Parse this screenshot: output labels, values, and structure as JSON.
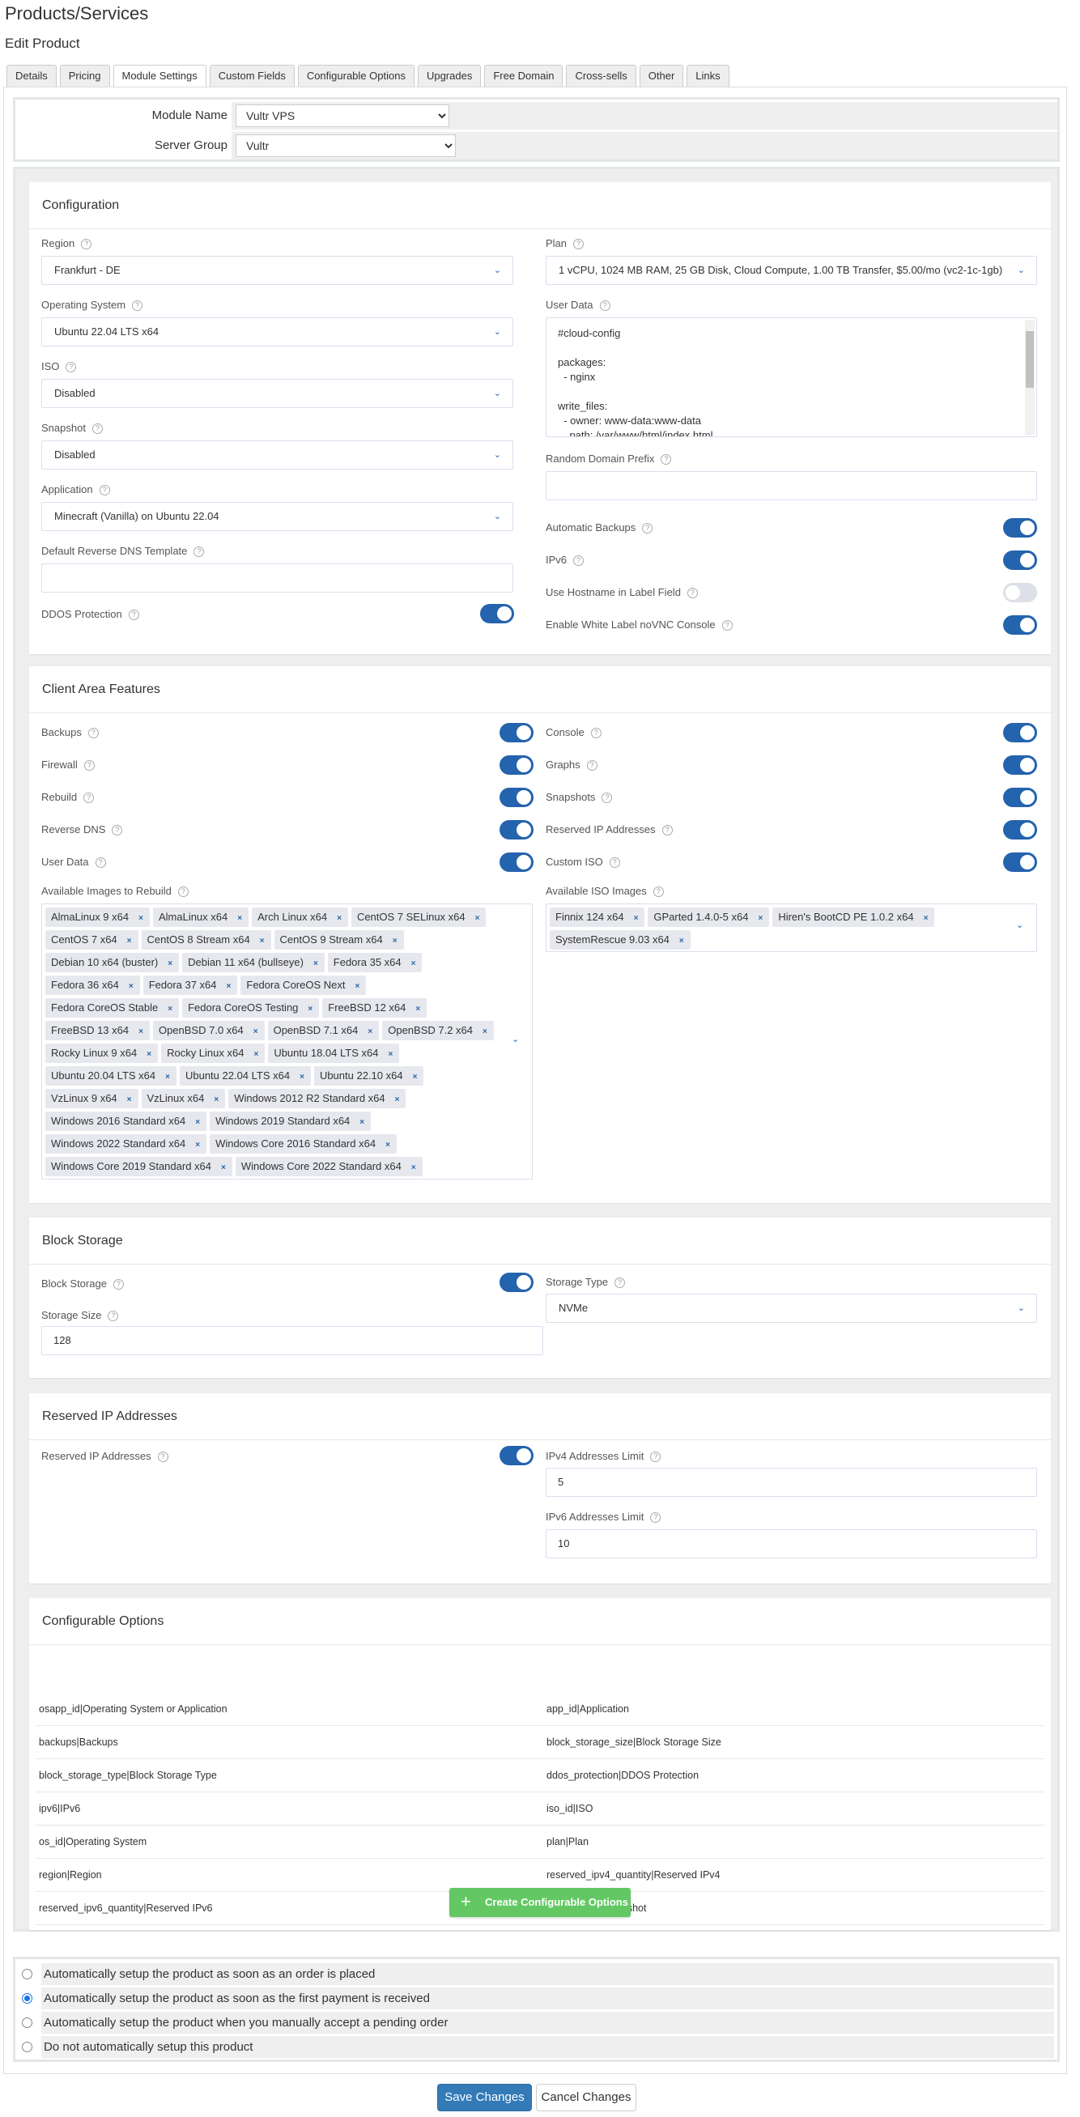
{
  "page": {
    "title": "Products/Services",
    "subtitle": "Edit Product"
  },
  "tabs": [
    {
      "label": "Details"
    },
    {
      "label": "Pricing"
    },
    {
      "label": "Module Settings",
      "active": true
    },
    {
      "label": "Custom Fields"
    },
    {
      "label": "Configurable Options"
    },
    {
      "label": "Upgrades"
    },
    {
      "label": "Free Domain"
    },
    {
      "label": "Cross-sells"
    },
    {
      "label": "Other"
    },
    {
      "label": "Links"
    }
  ],
  "module": {
    "name_label": "Module Name",
    "name_value": "Vultr VPS",
    "group_label": "Server Group",
    "group_value": "Vultr"
  },
  "help_glyph": "?",
  "chevron_glyph": "⌄",
  "remove_glyph": "×",
  "configuration": {
    "title": "Configuration",
    "region": {
      "label": "Region",
      "value": "Frankfurt - DE"
    },
    "os": {
      "label": "Operating System",
      "value": "Ubuntu 22.04 LTS x64"
    },
    "iso": {
      "label": "ISO",
      "value": "Disabled"
    },
    "snapshot": {
      "label": "Snapshot",
      "value": "Disabled"
    },
    "application": {
      "label": "Application",
      "value": "Minecraft (Vanilla) on Ubuntu 22.04"
    },
    "rdns": {
      "label": "Default Reverse DNS Template",
      "value": ""
    },
    "ddos": {
      "label": "DDOS Protection",
      "on": true
    },
    "plan": {
      "label": "Plan",
      "value": "1 vCPU, 1024 MB RAM, 25 GB Disk, Cloud Compute, 1.00 TB Transfer, $5.00/mo (vc2-1c-1gb)"
    },
    "user_data": {
      "label": "User Data",
      "value": "#cloud-config\n\npackages:\n  - nginx\n\nwrite_files:\n  - owner: www-data:www-data\n    path: /var/www/html/index.html"
    },
    "random_prefix": {
      "label": "Random Domain Prefix",
      "value": ""
    },
    "auto_backups": {
      "label": "Automatic Backups",
      "on": true
    },
    "ipv6": {
      "label": "IPv6",
      "on": true
    },
    "hostname_label": {
      "label": "Use Hostname in Label Field",
      "on": false
    },
    "white_label": {
      "label": "Enable White Label noVNC Console",
      "on": true
    }
  },
  "client_area": {
    "title": "Client Area Features",
    "left": [
      {
        "label": "Backups",
        "on": true
      },
      {
        "label": "Firewall",
        "on": true
      },
      {
        "label": "Rebuild",
        "on": true
      },
      {
        "label": "Reverse DNS",
        "on": true
      },
      {
        "label": "User Data",
        "on": true
      }
    ],
    "right": [
      {
        "label": "Console",
        "on": true
      },
      {
        "label": "Graphs",
        "on": true
      },
      {
        "label": "Snapshots",
        "on": true
      },
      {
        "label": "Reserved IP Addresses",
        "on": true
      },
      {
        "label": "Custom ISO",
        "on": true
      }
    ],
    "images_label": "Available Images to Rebuild",
    "images": [
      "AlmaLinux 9 x64",
      "AlmaLinux x64",
      "Arch Linux x64",
      "CentOS 7 SELinux x64",
      "CentOS 7 x64",
      "CentOS 8 Stream x64",
      "CentOS 9 Stream x64",
      "Debian 10 x64 (buster)",
      "Debian 11 x64 (bullseye)",
      "Fedora 35 x64",
      "Fedora 36 x64",
      "Fedora 37 x64",
      "Fedora CoreOS Next",
      "Fedora CoreOS Stable",
      "Fedora CoreOS Testing",
      "FreeBSD 12 x64",
      "FreeBSD 13 x64",
      "OpenBSD 7.0 x64",
      "OpenBSD 7.1 x64",
      "OpenBSD 7.2 x64",
      "Rocky Linux 9 x64",
      "Rocky Linux x64",
      "Ubuntu 18.04 LTS x64",
      "Ubuntu 20.04 LTS x64",
      "Ubuntu 22.04 LTS x64",
      "Ubuntu 22.10 x64",
      "VzLinux 9 x64",
      "VzLinux x64",
      "Windows 2012 R2 Standard x64",
      "Windows 2016 Standard x64",
      "Windows 2019 Standard x64",
      "Windows 2022 Standard x64",
      "Windows Core 2016 Standard x64",
      "Windows Core 2019 Standard x64",
      "Windows Core 2022 Standard x64"
    ],
    "iso_label": "Available ISO Images",
    "isos": [
      "Finnix 124 x64",
      "GParted 1.4.0-5 x64",
      "Hiren's BootCD PE 1.0.2 x64",
      "SystemRescue 9.03 x64"
    ]
  },
  "block_storage": {
    "title": "Block Storage",
    "enabled": {
      "label": "Block Storage",
      "on": true
    },
    "size": {
      "label": "Storage Size",
      "value": "128"
    },
    "type": {
      "label": "Storage Type",
      "value": "NVMe"
    }
  },
  "reserved_ip": {
    "title": "Reserved IP Addresses",
    "enabled": {
      "label": "Reserved IP Addresses",
      "on": true
    },
    "ipv4": {
      "label": "IPv4 Addresses Limit",
      "value": "5"
    },
    "ipv6": {
      "label": "IPv6 Addresses Limit",
      "value": "10"
    }
  },
  "configurable_options": {
    "title": "Configurable Options",
    "rows": [
      [
        "osapp_id|Operating System or Application",
        "app_id|Application"
      ],
      [
        "backups|Backups",
        "block_storage_size|Block Storage Size"
      ],
      [
        "block_storage_type|Block Storage Type",
        "ddos_protection|DDOS Protection"
      ],
      [
        "ipv6|IPv6",
        "iso_id|ISO"
      ],
      [
        "os_id|Operating System",
        "plan|Plan"
      ],
      [
        "region|Region",
        "reserved_ipv4_quantity|Reserved IPv4"
      ],
      [
        "reserved_ipv6_quantity|Reserved IPv6",
        "snapshot_id|Snapshot"
      ]
    ],
    "create_label": "Create Configurable Options",
    "plus_glyph": "+"
  },
  "setup_options": [
    {
      "label": "Automatically setup the product as soon as an order is placed",
      "checked": false
    },
    {
      "label": "Automatically setup the product as soon as the first payment is received",
      "checked": true
    },
    {
      "label": "Automatically setup the product when you manually accept a pending order",
      "checked": false
    },
    {
      "label": "Do not automatically setup this product",
      "checked": false
    }
  ],
  "actions": {
    "save": "Save Changes",
    "cancel": "Cancel Changes"
  }
}
